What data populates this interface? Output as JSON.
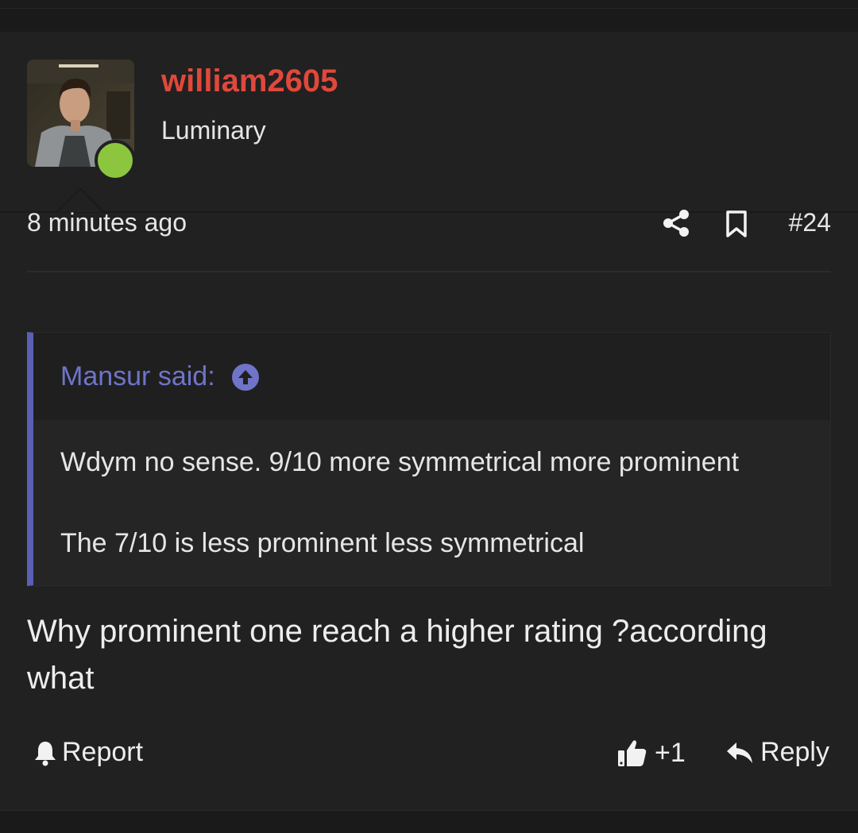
{
  "post": {
    "author": {
      "username": "william2605",
      "title": "Luminary",
      "online": true
    },
    "timestamp": "8 minutes ago",
    "number": "#24",
    "quote": {
      "attribution": "Mansur said:",
      "lines": [
        "Wdym no sense. 9/10 more symmetrical more prominent",
        "The 7/10 is less prominent less symmetrical"
      ]
    },
    "message": "Why prominent one reach a higher rating ?according what",
    "actions": {
      "report_label": "Report",
      "like_label": "+1",
      "reply_label": "Reply"
    }
  },
  "colors": {
    "username": "#e0483b",
    "quote_accent": "#5b5fb5",
    "online": "#8cc63f",
    "background": "#212121"
  },
  "icons": [
    "share-icon",
    "bookmark-icon",
    "jump-to-quote-icon",
    "bell-icon",
    "thumbs-up-icon",
    "reply-icon"
  ]
}
